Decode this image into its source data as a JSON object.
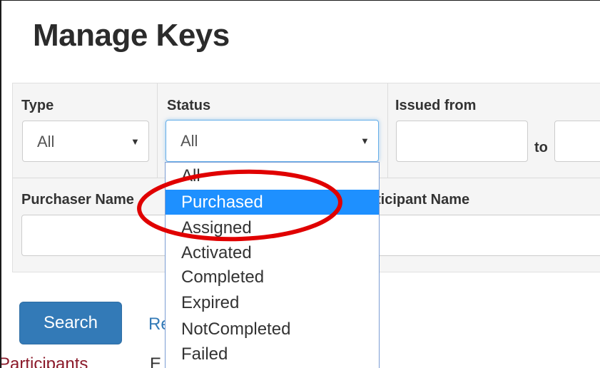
{
  "page": {
    "title": "Manage Keys"
  },
  "filters": {
    "type": {
      "label": "Type",
      "value": "All"
    },
    "status": {
      "label": "Status",
      "value": "All"
    },
    "issued": {
      "label": "Issued from",
      "to_label": "to",
      "from_value": "",
      "to_value": ""
    },
    "purchaser": {
      "label": "Purchaser Name",
      "value": ""
    },
    "participant": {
      "label": "ticipant Name",
      "value": ""
    }
  },
  "status_dropdown": {
    "options": [
      "All",
      "Purchased",
      "Assigned",
      "Activated",
      "Completed",
      "Expired",
      "NotCompleted",
      "Failed"
    ],
    "highlighted": "Purchased"
  },
  "actions": {
    "search_label": "Search",
    "reset_label": "Re"
  },
  "bottom_tabs": {
    "participants_label": "Participants",
    "other_label": "E"
  },
  "colors": {
    "primary": "#337ab7",
    "highlight": "#1e90ff",
    "annotation": "#e00000",
    "link_dark": "#8b1a2a"
  }
}
